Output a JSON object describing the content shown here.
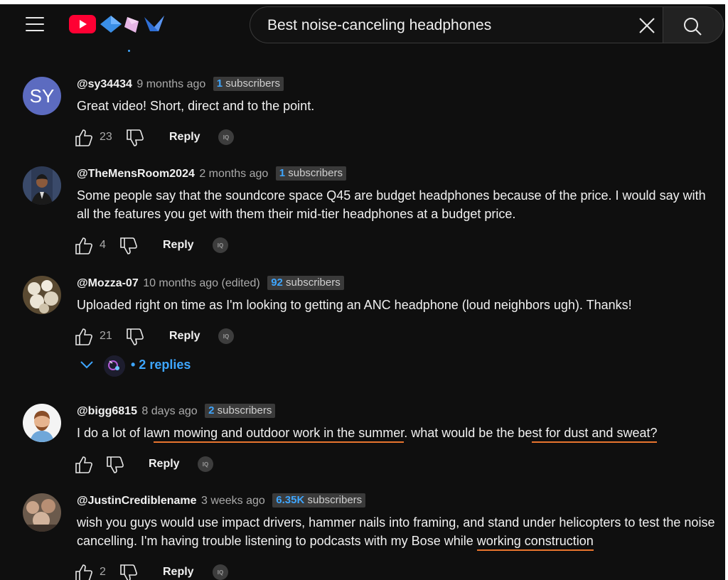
{
  "header": {
    "search_query": "Best noise-canceling headphones"
  },
  "comments": [
    {
      "avatar_initials": "SY",
      "handle": "@sy34434",
      "time": "9 months ago",
      "subs_count": "1",
      "subs_label": "subscribers",
      "text": "Great video! Short, direct and to the point.",
      "likes": "23",
      "reply_label": "Reply",
      "iq_label": "IQ"
    },
    {
      "handle": "@TheMensRoom2024",
      "time": "2 months ago",
      "subs_count": "1",
      "subs_label": "subscribers",
      "text": "Some people say that the soundcore space Q45 are budget headphones because of the price. I would say with all the features you get with them their mid-tier headphones at a budget price.",
      "likes": "4",
      "reply_label": "Reply",
      "iq_label": "IQ"
    },
    {
      "handle": "@Mozza-07",
      "time": "10 months ago (edited)",
      "subs_count": "92",
      "subs_label": "subscribers",
      "text": "Uploaded right on time as I'm looking to getting an ANC headphone (loud neighbors ugh). Thanks!",
      "likes": "21",
      "reply_label": "Reply",
      "iq_label": "IQ",
      "replies_label": "• 2 replies"
    },
    {
      "handle": "@bigg6815",
      "time": "8 days ago",
      "subs_count": "2",
      "subs_label": "subscribers",
      "text_parts": [
        "I do a lot of la",
        "wn mowing and outdoor work in the summer",
        ". what would be the be",
        "st for dust and sweat?"
      ],
      "reply_label": "Reply",
      "iq_label": "IQ"
    },
    {
      "handle": "@JustinCrediblename",
      "time": "3 weeks ago",
      "subs_count": "6.35K",
      "subs_label": "subscribers",
      "text_parts": [
        "wish you guys would use impact drivers, hammer nails into framing, and stand under helicopters to test the noise cancelling. I'm having trouble listening to podcasts with my Bose while ",
        "working construction"
      ],
      "likes": "2",
      "reply_label": "Reply",
      "iq_label": "IQ"
    }
  ],
  "colors": {
    "background": "#0f0f0f",
    "link_blue": "#3ea6ff",
    "underline_orange": "#e8742e",
    "youtube_red": "#ff0033"
  },
  "icons": [
    "menu-icon",
    "youtube-logo-icon",
    "diamond-icon",
    "crystal-icon",
    "crane-icon",
    "close-icon",
    "search-icon",
    "thumb-up-icon",
    "thumb-down-icon",
    "chevron-down-icon"
  ]
}
